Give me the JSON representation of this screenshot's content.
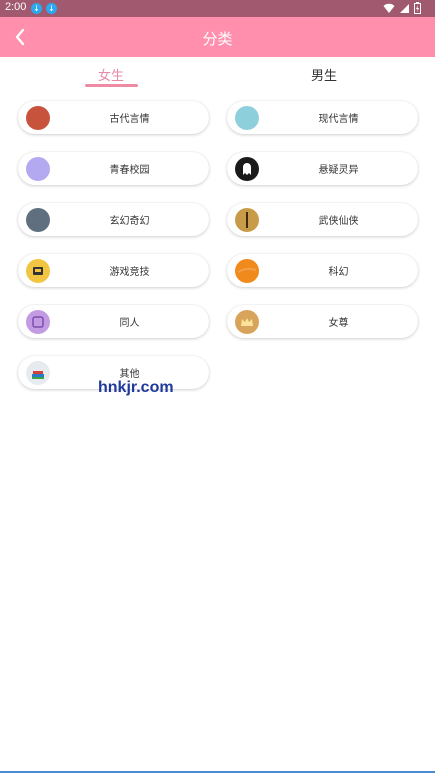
{
  "status_bar": {
    "time": "2:00"
  },
  "header": {
    "title": "分类"
  },
  "tabs": [
    {
      "label": "女生",
      "selected": true
    },
    {
      "label": "男生",
      "selected": false
    }
  ],
  "categories": [
    {
      "label": "古代言情",
      "icon": "ancient-romance-icon",
      "color": "#c8533d"
    },
    {
      "label": "现代言情",
      "icon": "modern-romance-icon",
      "color": "#8ecfdc"
    },
    {
      "label": "青春校园",
      "icon": "campus-icon",
      "color": "#b3a9f1"
    },
    {
      "label": "悬疑灵异",
      "icon": "ghost-icon",
      "color": "#1a1a1a"
    },
    {
      "label": "玄幻奇幻",
      "icon": "fantasy-icon",
      "color": "#5f6f7f"
    },
    {
      "label": "武侠仙侠",
      "icon": "sword-icon",
      "color": "#c79b48"
    },
    {
      "label": "游戏竞技",
      "icon": "game-icon",
      "color": "#f1c542"
    },
    {
      "label": "科幻",
      "icon": "planet-icon",
      "color": "#f08a1c"
    },
    {
      "label": "同人",
      "icon": "fan-fiction-icon",
      "color": "#c39be3"
    },
    {
      "label": "女尊",
      "icon": "crown-icon",
      "color": "#d8a35a"
    },
    {
      "label": "其他",
      "icon": "books-icon",
      "color": "#b9c3cc"
    }
  ],
  "watermark": "hnkjr.com"
}
